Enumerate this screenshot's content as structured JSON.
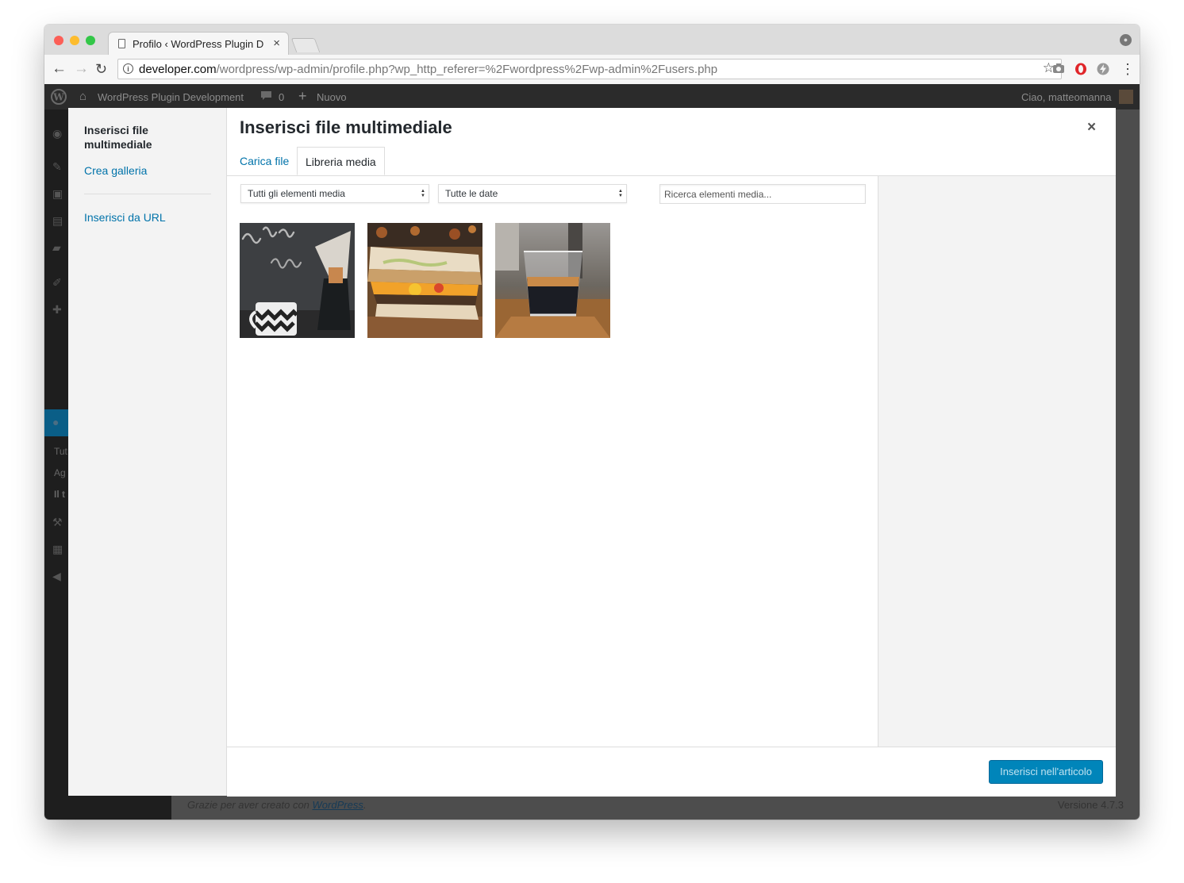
{
  "browser": {
    "tab_title": "Profilo ‹ WordPress Plugin Dev",
    "tab_close": "×",
    "url_host": "developer.com",
    "url_path": "/wordpress/wp-admin/profile.php?wp_http_referer=%2Fwordpress%2Fwp-admin%2Fusers.php",
    "info_glyph": "i",
    "back_glyph": "←",
    "forward_glyph": "→",
    "reload_glyph": "↻",
    "star_glyph": "☆",
    "menu_glyph": "⋮",
    "traffic_colors": [
      "#fc5f57",
      "#fdbc2e",
      "#33c748"
    ]
  },
  "wp_admin_bar": {
    "site_name": "WordPress Plugin Development",
    "comments_count": "0",
    "new_label": "Nuovo",
    "greeting": "Ciao, matteomanna"
  },
  "admin_sidebar": {
    "submenu": [
      "Tut",
      "Ag",
      "Il t"
    ]
  },
  "admin_footer": {
    "thanks_prefix": "Grazie per aver creato con",
    "thanks_link": "WordPress",
    "thanks_suffix": ".",
    "version": "Versione 4.7.3"
  },
  "media_modal": {
    "title": "Inserisci file multimediale",
    "close_glyph": "×",
    "menu": {
      "active": "Inserisci file multimediale",
      "gallery": "Crea galleria",
      "from_url": "Inserisci da URL"
    },
    "tabs": {
      "upload": "Carica file",
      "library": "Libreria media"
    },
    "filters": {
      "type_selected": "Tutti gli elementi media",
      "date_selected": "Tutte le date",
      "search_placeholder": "Ricerca elementi media..."
    },
    "attachments": [
      {
        "subject": "coffee time chalkboard with mug and chemex"
      },
      {
        "subject": "sandwich"
      },
      {
        "subject": "espresso glass"
      }
    ],
    "insert_button": "Inserisci nell'articolo",
    "colors": {
      "link": "#0073aa",
      "primary_button": "#0085ba",
      "sidebar_bg": "#f3f3f3",
      "admin_bar": "#2b2b2b"
    }
  }
}
